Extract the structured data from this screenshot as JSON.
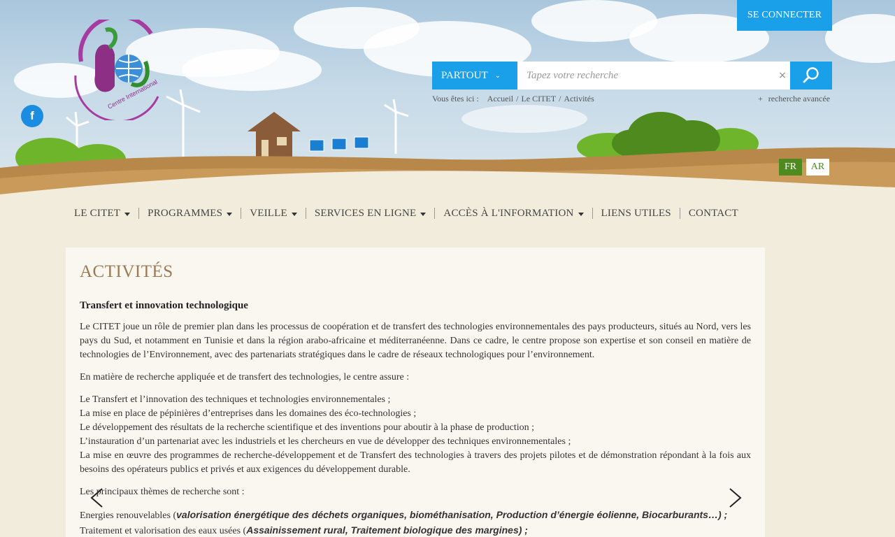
{
  "header": {
    "connect_label": "SE CONNECTER",
    "logo_alt": "Centre International des Technologies de l'Environnement de Tunis",
    "facebook_glyph": "f"
  },
  "search": {
    "scope_label": "PARTOUT",
    "placeholder": "Tapez votre recherche",
    "clear_glyph": "×"
  },
  "breadcrumb": {
    "prefix": "Vous êtes ici :",
    "items": [
      "Accueil",
      "Le CITET",
      "Activités"
    ],
    "separator": "/"
  },
  "advanced_search": "recherche avancée",
  "languages": {
    "fr": "FR",
    "ar": "AR"
  },
  "nav": {
    "items": [
      {
        "label": "LE CITET",
        "dropdown": true
      },
      {
        "label": "PROGRAMMES",
        "dropdown": true
      },
      {
        "label": "VEILLE",
        "dropdown": true
      },
      {
        "label": "SERVICES EN LIGNE",
        "dropdown": true
      },
      {
        "label": "ACCÈS À L'INFORMATION",
        "dropdown": true
      },
      {
        "label": "LIENS UTILES",
        "dropdown": false
      },
      {
        "label": "CONTACT",
        "dropdown": false
      }
    ]
  },
  "content": {
    "title": "ACTIVITÉS",
    "subtitle": "Transfert et innovation technologique",
    "para1": "Le CITET joue un rôle de premier plan dans les processus de coopération et de transfert des technologies environnementales des pays producteurs, situés au Nord, vers les pays du Sud, et notamment en Tunisie et dans la région arabo-africaine et méditerranéenne. Dans ce cadre, le centre  propose son expertise et son conseil en matière de technologies de l’Environnement, avec des partenariats stratégiques dans le cadre de  réseaux technologiques pour l’environnement.",
    "para2": "En matière de recherche appliquée et de transfert des technologies, le centre assure :",
    "list": [
      "Le Transfert et l’innovation des techniques et technologies environnementales ;",
      "La mise en place de pépinières d’entreprises dans les domaines des éco-technologies ;",
      "Le développement des résultats de la recherche scientifique et des inventions pour aboutir à la phase de production ;",
      "L’instauration d’un partenariat avec les industriels et les chercheurs en vue de développer des techniques environnementales ;",
      "La mise en œuvre des programmes de recherche-développement et de Transfert des technologies à travers des projets pilotes et de démonstration répondant à la fois aux besoins des opérateurs publics et privés et aux exigences du développement durable."
    ],
    "para3": "Les principaux thèmes de recherche  sont :",
    "themes": [
      {
        "label": "Energies renouvelables (",
        "detail": "valorisation énergétique des déchets organiques, biométhanisation, Production d’énergie éolienne, Biocarburants…) ;"
      },
      {
        "label": "Traitement et valorisation des eaux usées (",
        "detail": "Assainissement rural, Traitement biologique des margines) ;"
      }
    ]
  },
  "colors": {
    "accent_blue": "#1aa0e8",
    "title_brown": "#9a7a55",
    "lang_green": "#4e8a1e",
    "page_bg": "#f1ecdc",
    "content_bg": "#f9f7f0"
  }
}
